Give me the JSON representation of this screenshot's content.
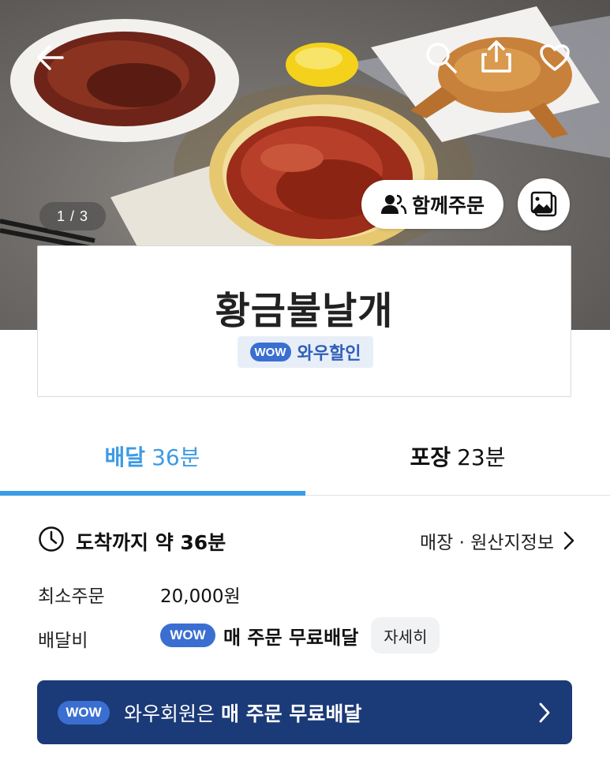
{
  "hero": {
    "page_indicator": "1 / 3",
    "group_order_label": "함께주문"
  },
  "store": {
    "name": "황금불날개",
    "badge_wow": "WOW",
    "badge_text": "와우할인"
  },
  "tabs": [
    {
      "label": "배달",
      "time": "36분",
      "active": true
    },
    {
      "label": "포장",
      "time": "23분",
      "active": false
    }
  ],
  "info": {
    "arrival_text": "도착까지 약 36분",
    "origin_link": "매장 · 원산지정보",
    "min_order_label": "최소주문",
    "min_order_value": "20,000원",
    "delivery_fee_label": "배달비",
    "delivery_fee_wow": "WOW",
    "delivery_fee_text": "매 주문 무료배달",
    "detail_button": "자세히"
  },
  "banner": {
    "wow": "WOW",
    "text_prefix": "와우회원은",
    "text_bold": "매 주문 무료배달"
  },
  "colors": {
    "accent_blue": "#3c9be5",
    "wow_blue": "#3a6fd1",
    "banner_navy": "#1b3a78"
  },
  "icons": [
    "back-arrow-icon",
    "search-icon",
    "share-icon",
    "heart-icon",
    "people-icon",
    "photo-gallery-icon",
    "clock-icon",
    "chevron-right-icon"
  ]
}
